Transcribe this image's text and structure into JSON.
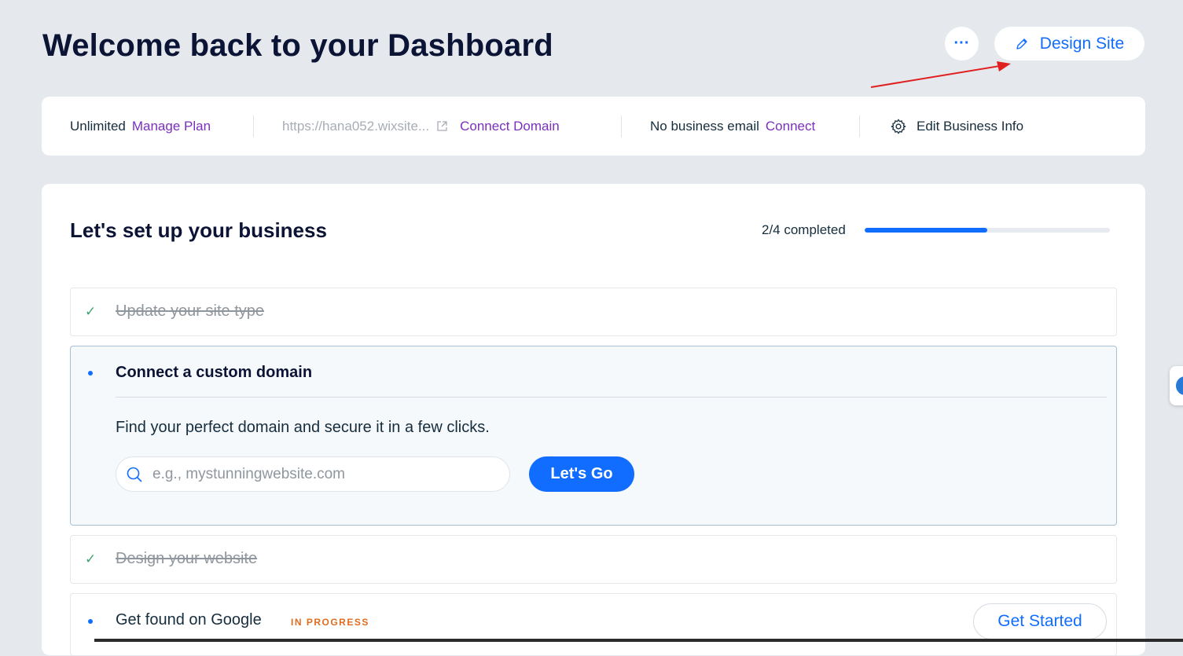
{
  "header": {
    "title": "Welcome back to your Dashboard",
    "more_label": "···",
    "design_site_label": "Design Site"
  },
  "info_bar": {
    "plan_text": "Unlimited",
    "manage_plan_label": "Manage Plan",
    "site_url": "https://hana052.wixsite...",
    "connect_domain_label": "Connect Domain",
    "email_text": "No business email",
    "connect_email_label": "Connect",
    "edit_business_label": "Edit Business Info"
  },
  "setup": {
    "title": "Let's set up your business",
    "progress_label": "2/4 completed",
    "progress": 0.5,
    "steps": [
      {
        "label": "Update your site type",
        "status": "done"
      },
      {
        "label": "Connect a custom domain",
        "status": "active",
        "description": "Find your perfect domain and secure it in a few clicks.",
        "search_placeholder": "e.g., mystunningwebsite.com",
        "button_label": "Let's Go"
      },
      {
        "label": "Design your website",
        "status": "done"
      },
      {
        "label": "Get found on Google",
        "status": "in-progress",
        "badge": "IN PROGRESS",
        "button_label": "Get Started"
      }
    ]
  },
  "colors": {
    "accent": "#116dff",
    "link_purple": "#7b2fbd",
    "done_check": "#3da36f",
    "badge_orange": "#e06c1f",
    "annotation_arrow": "#e02020"
  },
  "icons": [
    "more-icon",
    "pencil-icon",
    "external-link-icon",
    "gear-icon",
    "check-icon",
    "search-icon"
  ]
}
